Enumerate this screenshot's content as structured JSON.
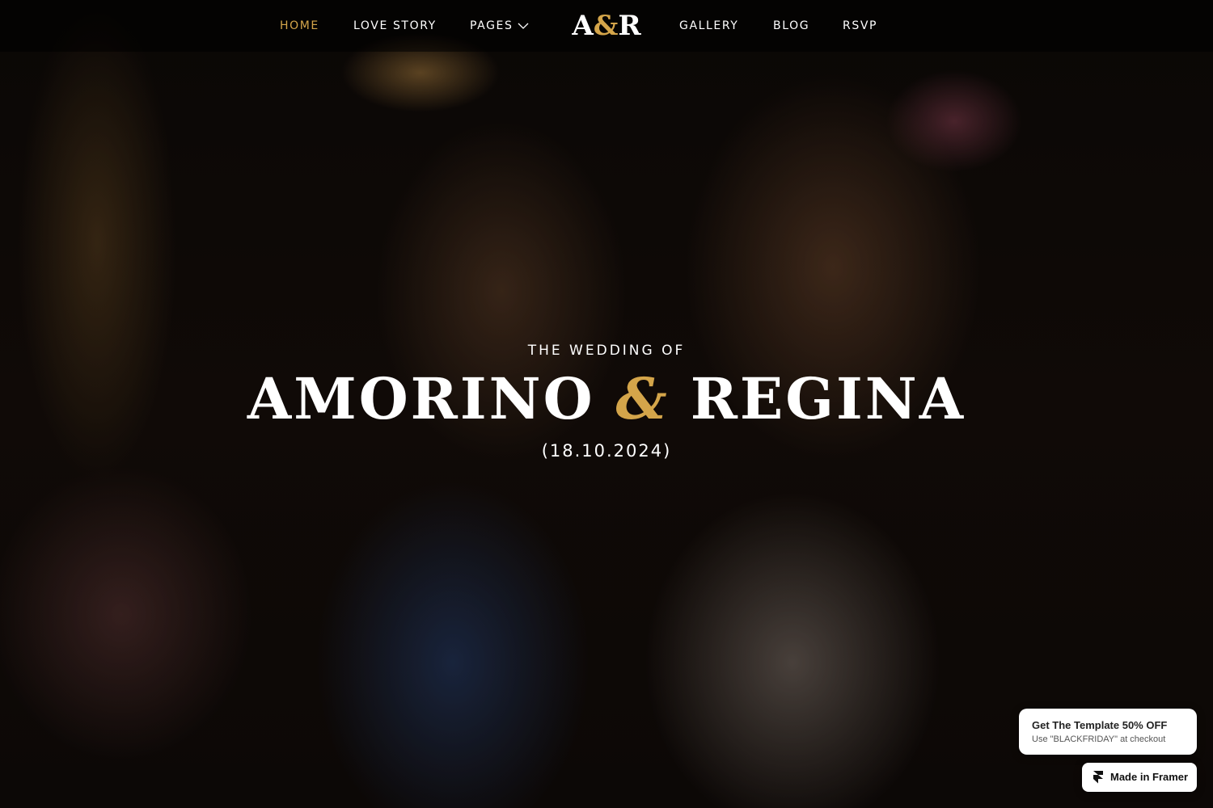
{
  "nav": {
    "items": [
      {
        "label": "HOME",
        "active": true
      },
      {
        "label": "LOVE STORY"
      },
      {
        "label": "PAGES",
        "icon": "chevron-down-icon"
      },
      {
        "label": "GALLERY"
      },
      {
        "label": "BLOG"
      },
      {
        "label": "RSVP"
      }
    ],
    "logo": {
      "left": "A",
      "amp": "&",
      "right": "R"
    }
  },
  "hero": {
    "eyebrow": "THE WEDDING OF",
    "name_left": "AMORINO",
    "ampersand": "&",
    "name_right": "REGINA",
    "date": "(18.10.2024)"
  },
  "promo": {
    "title": "Get The Template 50% OFF",
    "subtitle": "Use \"BLACKFRIDAY\" at checkout"
  },
  "framer_badge": {
    "label": "Made in Framer",
    "icon": "framer-logo-icon"
  },
  "colors": {
    "accent": "#d4a54a",
    "text": "#ffffff"
  }
}
